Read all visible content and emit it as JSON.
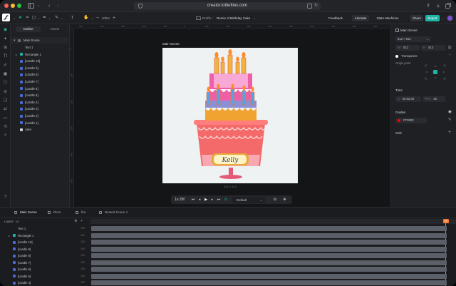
{
  "browser": {
    "url": "creator.lottiefiles.com"
  },
  "toolbar": {
    "zoom": "100%",
    "breadcrumb_root": "Drafts",
    "breadcrumb_sep": "/",
    "file_name": "Remix of Birthday Cake",
    "feedback": "Feedback",
    "animate": "Animate",
    "state_machines": "State Machines",
    "share": "Share",
    "export": "Export"
  },
  "layers_panel": {
    "tab_outline": "Outline",
    "tab_assets": "Assets",
    "scene": "Main Scene",
    "items": [
      {
        "label": "Text 1",
        "type": "text",
        "expand": false
      },
      {
        "label": "Rectangle 1",
        "type": "shape",
        "expand": true
      },
      {
        "label": "[candle 10]",
        "type": "precomp"
      },
      {
        "label": "[candle 9]",
        "type": "precomp"
      },
      {
        "label": "[candle 8]",
        "type": "precomp"
      },
      {
        "label": "[candle 7]",
        "type": "precomp"
      },
      {
        "label": "[candle 6]",
        "type": "precomp"
      },
      {
        "label": "[candle 5]",
        "type": "precomp"
      },
      {
        "label": "[candle 4]",
        "type": "precomp"
      },
      {
        "label": "[candle 3]",
        "type": "precomp"
      },
      {
        "label": "[candle 2]",
        "type": "precomp"
      },
      {
        "label": "[candle 1]",
        "type": "precomp"
      },
      {
        "label": "cake",
        "type": "image"
      }
    ]
  },
  "canvas": {
    "artboard_title": "Main Scene",
    "artboard_size": "512 × 512",
    "cake_label": "Kelly",
    "ruler_ticks": [
      "-500",
      "-400",
      "-300",
      "-200",
      "-100",
      "0",
      "100",
      "200",
      "300",
      "400",
      "500",
      "600",
      "700",
      "800",
      "900"
    ],
    "ruler_v_ticks": [
      "0",
      "100",
      "200",
      "300",
      "400",
      "500"
    ]
  },
  "playback": {
    "time": "1s 29f",
    "preset": "Default"
  },
  "properties": {
    "scene_title": "Main Scene",
    "scene_size": "512 × 512",
    "width": "512",
    "height": "512",
    "width_label": "W",
    "height_label": "H",
    "background": "Transparent",
    "origin_label": "Origin point",
    "time_title": "Time",
    "time_value": "00:02:00",
    "fps_label": "FPS",
    "fps_value": "30",
    "guides_title": "Guides",
    "guide_color": "FF0000",
    "grid_title": "Grid"
  },
  "timeline": {
    "tabs": [
      "Main Scene",
      "Rims",
      "fire",
      "Nested Scene 4"
    ],
    "layers_label": "Layers",
    "layer_count": "14",
    "rows": [
      "Text 1",
      "Rectangle 1",
      "[candle 10]",
      "[candle 9]",
      "[candle 8]",
      "[candle 7]",
      "[candle 6]",
      "[candle 5]",
      "[candle 4]"
    ],
    "row_values": [
      "100",
      "100",
      "100",
      "100",
      "100",
      "100",
      "100",
      "100",
      "100"
    ],
    "playhead_frame": "59"
  },
  "colors": {
    "accent": "#1fb4a4",
    "export": "#1fb4a4",
    "playhead": "#f0782a",
    "layer_icon": "#4b6ad6"
  }
}
